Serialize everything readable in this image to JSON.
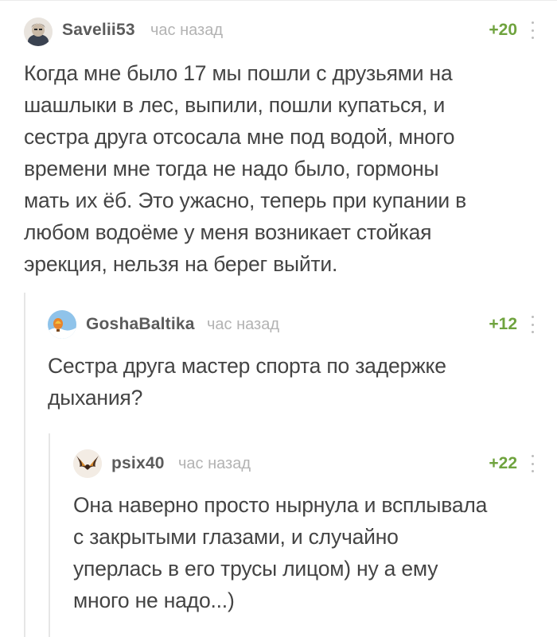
{
  "comments": [
    {
      "username": "Savelii53",
      "time": "час назад",
      "rating": "+20",
      "avatar": "avatar-savelii53",
      "text_lines": [
        "Когда мне было 17 мы пошли с друзьями на",
        "шашлыки в лес, выпили, пошли купаться, и",
        "сестра друга отсосала мне под водой, много",
        "времени мне тогда не надо было, гормоны",
        "мать их ёб. Это ужасно, теперь при купании в",
        "любом водоёме у меня возникает стойкая",
        "эрекция, нельзя на берег выйти."
      ]
    },
    {
      "username": "GoshaBaltika",
      "time": "час назад",
      "rating": "+12",
      "avatar": "avatar-goshabaltika",
      "text_lines": [
        "Сестра друга мастер спорта по задержке",
        "дыхания?"
      ]
    },
    {
      "username": "psix40",
      "time": "час назад",
      "rating": "+22",
      "avatar": "avatar-psix40",
      "text_lines": [
        "Она наверно просто нырнула и всплывала",
        "с закрытыми глазами, и случайно",
        "уперлась в его трусы лицом) ну а ему",
        "много не надо...)"
      ]
    }
  ],
  "colors": {
    "rating_positive": "#6fa33e",
    "username": "#5b5b5b",
    "time": "#b3b3b3",
    "text": "#444444",
    "thread_line": "#e6e6e6"
  }
}
